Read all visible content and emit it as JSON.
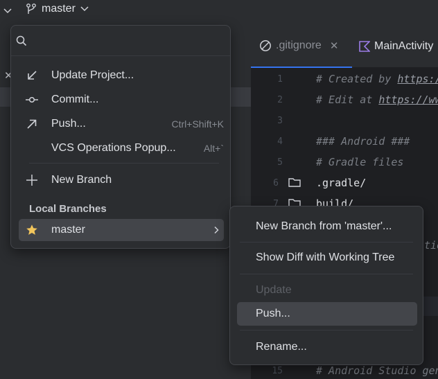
{
  "toolbar": {
    "branch_name": "master"
  },
  "editor": {
    "tabs": [
      {
        "label": ".gitignore",
        "active": true
      },
      {
        "label": "MainActivity"
      }
    ],
    "lines": [
      {
        "num": "1",
        "prefix": "# Created by ",
        "link": "https:/"
      },
      {
        "num": "2",
        "prefix": "# Edit at ",
        "link": "https://ww"
      },
      {
        "num": "3",
        "text": ""
      },
      {
        "num": "4",
        "text": "### Android ###"
      },
      {
        "num": "5",
        "text": "# Gradle files"
      },
      {
        "num": "6",
        "text": ".gradle/"
      },
      {
        "num": "7",
        "text": "build/"
      },
      {
        "partial": "tio"
      },
      {
        "num": "15",
        "text": "# Android Studio gen"
      }
    ]
  },
  "popup": {
    "search": {
      "value": "",
      "placeholder": ""
    },
    "actions": [
      {
        "label": "Update Project...",
        "icon": "update-arrow-icon"
      },
      {
        "label": "Commit...",
        "icon": "commit-icon"
      },
      {
        "label": "Push...",
        "icon": "push-arrow-icon",
        "shortcut": "Ctrl+Shift+K"
      },
      {
        "label": "VCS Operations Popup...",
        "shortcut": "Alt+`"
      },
      {
        "label": "New Branch",
        "icon": "plus-icon"
      }
    ],
    "local_branches_header": "Local Branches",
    "current_branch": {
      "label": "master",
      "icon": "star-icon"
    }
  },
  "submenu": {
    "items": [
      {
        "label": "New Branch from 'master'..."
      },
      {
        "label": "Show Diff with Working Tree"
      },
      {
        "label": "Update",
        "disabled": true
      },
      {
        "label": "Push...",
        "selected": true
      },
      {
        "label": "Rename..."
      }
    ]
  },
  "colors": {
    "background": "#1e1f22",
    "panel": "#2b2d30",
    "selection": "#43454a",
    "accent": "#3574f0",
    "star": "#f2c55c"
  }
}
